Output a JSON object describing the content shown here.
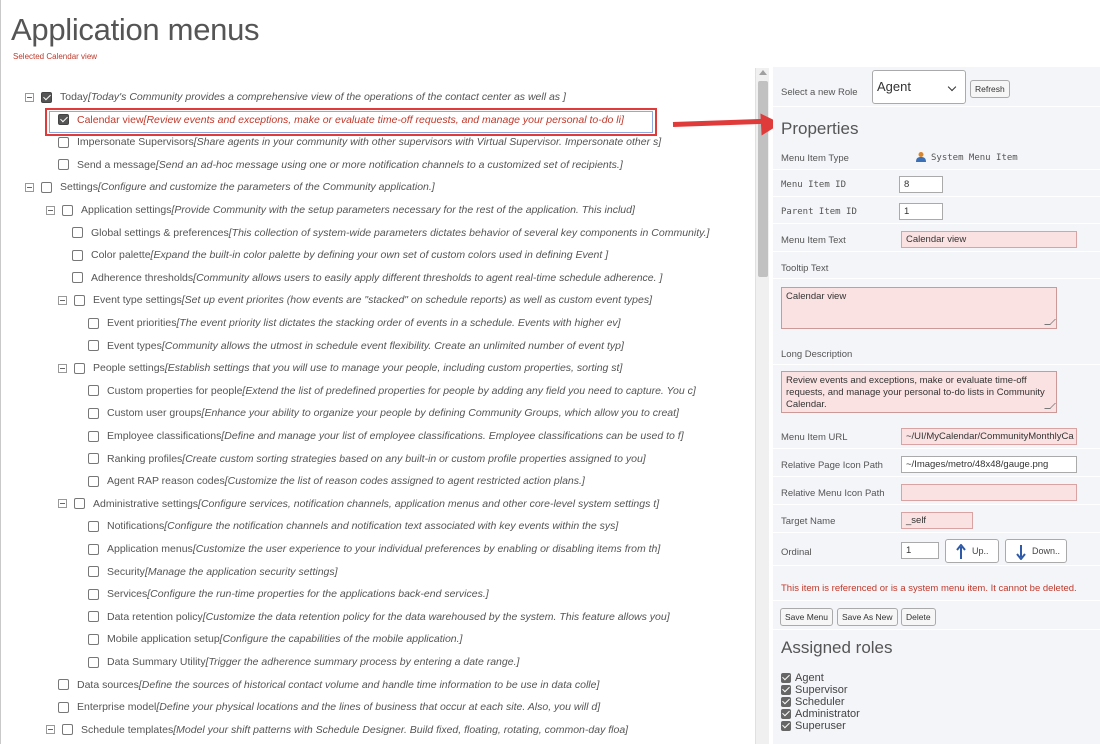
{
  "page": {
    "title": "Application menus",
    "subtitle": "Selected Calendar view"
  },
  "tree": [
    {
      "depth": 0,
      "expander": true,
      "checked": true,
      "label": "Today",
      "desc": "[Today's Community provides a comprehensive view of the operations of the contact center as well as ]"
    },
    {
      "depth": 1,
      "expander": false,
      "checked": true,
      "label": "Calendar view",
      "desc": "[Review events and exceptions, make or evaluate time-off requests, and manage your personal to-do li]",
      "highlight": true
    },
    {
      "depth": 1,
      "expander": false,
      "checked": false,
      "label": "Impersonate Supervisors",
      "desc": "[Share agents in your community with other supervisors with Virtual Supervisor. Impersonate other s]"
    },
    {
      "depth": 1,
      "expander": false,
      "checked": false,
      "label": "Send a message",
      "desc": "[Send an ad-hoc message using one or more notification channels to a customized set of recipients.]"
    },
    {
      "depth": 0,
      "expander": true,
      "checked": false,
      "label": "Settings",
      "desc": "[Configure and customize the parameters of the Community application.]"
    },
    {
      "depth": 1,
      "expander": true,
      "checked": false,
      "label": "Application settings",
      "desc": "[Provide Community with the setup parameters necessary for the rest of the application. This includ]"
    },
    {
      "depth": 2,
      "expander": false,
      "checked": false,
      "label": "Global settings & preferences",
      "desc": "[This collection of system-wide parameters dictates behavior of several key components in Community.]"
    },
    {
      "depth": 2,
      "expander": false,
      "checked": false,
      "label": "Color palette",
      "desc": "[Expand the built-in color palette by defining your own set of custom colors used in defining Event ]"
    },
    {
      "depth": 2,
      "expander": false,
      "checked": false,
      "label": "Adherence thresholds",
      "desc": "[Community allows users to easily apply different thresholds to agent real-time schedule adherence. ]"
    },
    {
      "depth": 2,
      "expander": true,
      "checked": false,
      "label": "Event type settings",
      "desc": "[Set up event priorites (how events are \"stacked\" on schedule reports) as well as custom event types]"
    },
    {
      "depth": 3,
      "expander": false,
      "checked": false,
      "label": "Event priorities",
      "desc": "[The event priority list dictates the stacking order of events in a schedule. Events with higher ev]"
    },
    {
      "depth": 3,
      "expander": false,
      "checked": false,
      "label": "Event types",
      "desc": "[Community allows the utmost in schedule event flexibility. Create an unlimited number of event typ]"
    },
    {
      "depth": 2,
      "expander": true,
      "checked": false,
      "label": "People settings",
      "desc": "[Establish settings that you will use to manage your people, including custom properties, sorting st]"
    },
    {
      "depth": 3,
      "expander": false,
      "checked": false,
      "label": "Custom properties for people",
      "desc": "[Extend the list of predefined properties for people by adding any field you need to capture. You c]"
    },
    {
      "depth": 3,
      "expander": false,
      "checked": false,
      "label": "Custom user groups",
      "desc": "[Enhance your ability to organize your people by defining Community Groups, which allow you to creat]"
    },
    {
      "depth": 3,
      "expander": false,
      "checked": false,
      "label": "Employee classifications",
      "desc": "[Define and manage your list of employee classifications. Employee classifications can be used to f]"
    },
    {
      "depth": 3,
      "expander": false,
      "checked": false,
      "label": "Ranking profiles",
      "desc": "[Create custom sorting strategies based on any built-in or custom profile properties assigned to you]"
    },
    {
      "depth": 3,
      "expander": false,
      "checked": false,
      "label": "Agent RAP reason codes",
      "desc": "[Customize the list of reason codes assigned to agent restricted action plans.]"
    },
    {
      "depth": 2,
      "expander": true,
      "checked": false,
      "label": "Administrative settings",
      "desc": "[Configure services, notification channels, application menus and other core-level system settings t]"
    },
    {
      "depth": 3,
      "expander": false,
      "checked": false,
      "label": "Notifications",
      "desc": "[Configure the notification channels and notification text associated with key events within the sys]"
    },
    {
      "depth": 3,
      "expander": false,
      "checked": false,
      "label": "Application menus",
      "desc": "[Customize the user experience to your individual preferences by enabling or disabling items from th]"
    },
    {
      "depth": 3,
      "expander": false,
      "checked": false,
      "label": "Security",
      "desc": "[Manage the application security settings]"
    },
    {
      "depth": 3,
      "expander": false,
      "checked": false,
      "label": "Services",
      "desc": "[Configure the run-time properties for the applications back-end services.]"
    },
    {
      "depth": 3,
      "expander": false,
      "checked": false,
      "label": "Data retention policy",
      "desc": "[Customize the data retention policy for the data warehoused by the system. This feature allows you]"
    },
    {
      "depth": 3,
      "expander": false,
      "checked": false,
      "label": "Mobile application setup",
      "desc": "[Configure the capabilities of the mobile application.]"
    },
    {
      "depth": 3,
      "expander": false,
      "checked": false,
      "label": "Data Summary Utility",
      "desc": "[Trigger the adherence summary process by entering a date range.]"
    },
    {
      "depth": 1,
      "expander": false,
      "checked": false,
      "label": "Data sources",
      "desc": "[Define the sources of historical contact volume and handle time information to be use in data colle]"
    },
    {
      "depth": 1,
      "expander": false,
      "checked": false,
      "label": "Enterprise model",
      "desc": "[Define your physical locations and the lines of business that occur at each site. Also, you will d]"
    },
    {
      "depth": 1,
      "expander": true,
      "checked": false,
      "label": "Schedule templates",
      "desc": "[Model your shift patterns with Schedule Designer. Build fixed, floating, rotating, common-day floa]"
    }
  ],
  "panel": {
    "role_label": "Select a new Role",
    "role_value": "Agent",
    "refresh_label": "Refresh",
    "properties_title": "Properties",
    "menu_item_type_label": "Menu Item Type",
    "menu_item_type_value": "System Menu Item",
    "menu_item_id_label": "Menu Item ID",
    "menu_item_id_value": "8",
    "parent_item_id_label": "Parent Item ID",
    "parent_item_id_value": "1",
    "menu_item_text_label": "Menu Item Text",
    "menu_item_text_value": "Calendar view",
    "tooltip_text_label": "Tooltip Text",
    "tooltip_text_value": "Calendar view",
    "long_description_label": "Long Description",
    "long_description_value": "Review events and exceptions, make or evaluate time-off requests, and manage your personal to-do lists in Community Calendar.",
    "menu_item_url_label": "Menu Item URL",
    "menu_item_url_value": "~/UI/MyCalendar/CommunityMonthlyCa",
    "relative_page_icon_label": "Relative Page Icon Path",
    "relative_page_icon_value": "~/Images/metro/48x48/gauge.png",
    "relative_menu_icon_label": "Relative Menu Icon Path",
    "relative_menu_icon_value": "",
    "target_name_label": "Target Name",
    "target_name_value": "_self",
    "ordinal_label": "Ordinal",
    "ordinal_value": "1",
    "up_label": "Up..",
    "down_label": "Down..",
    "warning": "This item is referenced or is a system menu item. It cannot be deleted.",
    "save_menu_label": "Save Menu",
    "save_as_new_label": "Save As New",
    "delete_label": "Delete",
    "assigned_roles_title": "Assigned roles",
    "roles": [
      "Agent",
      "Supervisor",
      "Scheduler",
      "Administrator",
      "Superuser"
    ]
  },
  "colors": {
    "accent_red": "#e03b3b",
    "highlight_text": "#c0392b",
    "panel_bg": "#f4f5f9",
    "field_pink": "#fbe2e2"
  }
}
